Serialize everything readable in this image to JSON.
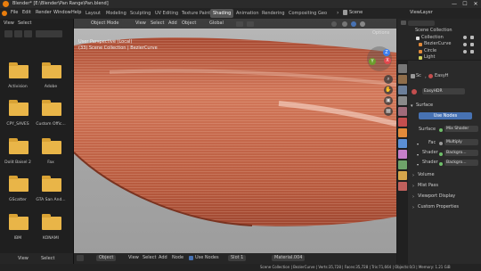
{
  "window": {
    "title": "Blender* [E:\\Blender\\Pan Range\\Pan.blend]",
    "minimize": "—",
    "maximize": "☐",
    "close": "✕"
  },
  "menu": {
    "items": [
      "File",
      "Edit",
      "Render",
      "Window",
      "Help"
    ],
    "workspaces": [
      "Layout",
      "Modeling",
      "Sculpting",
      "UV Editing",
      "Texture Paint",
      "Shading",
      "Animation",
      "Rendering",
      "Compositing",
      "Geo"
    ],
    "active_workspace": "Shading",
    "scene": "Scene",
    "view_layer": "ViewLayer"
  },
  "file_browser": {
    "header": [
      "View",
      "Select"
    ],
    "folders": [
      {
        "name": "Activision"
      },
      {
        "name": "Adobe"
      },
      {
        "name": "CPY_SAVES"
      },
      {
        "name": "Custom Offic..."
      },
      {
        "name": "Dolit Baisel 2"
      },
      {
        "name": "Fax"
      },
      {
        "name": "GScatter"
      },
      {
        "name": "GTA San And..."
      },
      {
        "name": "IBM"
      },
      {
        "name": "KONAMI"
      }
    ],
    "footer": [
      "View",
      "Select"
    ]
  },
  "viewport": {
    "mode": "Object Mode",
    "menus": [
      "View",
      "Select",
      "Add",
      "Object"
    ],
    "orientation": "Global",
    "overlay_title": "User Perspective (Local)",
    "overlay_subtitle": "(33) Scene Collection | BezierCurve",
    "options": "Options",
    "gizmo": {
      "x": "X",
      "y": "Y",
      "z": "Z"
    }
  },
  "shader_editor_header": {
    "editor": "Object",
    "menus": [
      "View",
      "Select",
      "Add",
      "Node"
    ],
    "use_nodes": "Use Nodes",
    "slot": "Slot 1",
    "material": "Material.004"
  },
  "outliner": {
    "title": "Scene Collection",
    "items": [
      "Collection",
      "BezierCurve",
      "Circle",
      "Light"
    ]
  },
  "properties": {
    "world_label": "Sc",
    "world_name": "EasyH",
    "world_datablock": "EasyHDR",
    "surface_section": "Surface",
    "use_nodes_btn": "Use Nodes",
    "surface_label": "Surface",
    "surface_value": "Mix Shader",
    "fac_label": "Fac",
    "fac_value": "Multiply",
    "shader1_label": "Shader",
    "shader1_value": "Backgro...",
    "shader2_label": "Shader",
    "shader2_value": "Backgro...",
    "sections": [
      "Volume",
      "Mist Pass",
      "Viewport Display",
      "Custom Properties"
    ]
  },
  "statusbar": {
    "text": "Scene Collection | BezierCurve | Verts:35,728 | Faces:35,728 | Tris:71,664 | Objects:0/3 | Memory: 1.21 GiB"
  },
  "colors": {
    "accent_blue": "#4772b3",
    "folder": "#e9b548",
    "hair": "#c86a4a"
  }
}
